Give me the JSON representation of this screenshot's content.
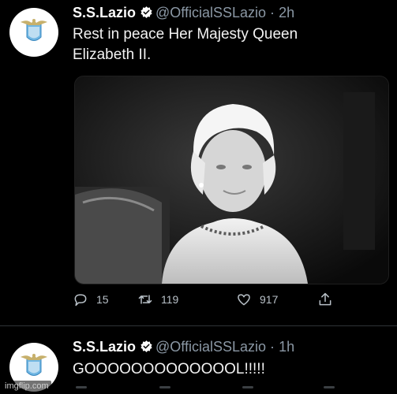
{
  "tweets": [
    {
      "author_name": "S.S.Lazio",
      "handle": "@OfficialSSLazio",
      "separator": "·",
      "time": "2h",
      "text_line1": "Rest in peace Her Majesty Queen",
      "text_line2": "Elizabeth II.",
      "media_icon": "portrait-photo",
      "stats": {
        "replies": "15",
        "retweets": "119",
        "likes": "917"
      }
    },
    {
      "author_name": "S.S.Lazio",
      "handle": "@OfficialSSLazio",
      "separator": "·",
      "time": "1h",
      "text": "GOOOOOOOOOOOOOL!!!!!"
    }
  ],
  "watermark": "imgflip.com",
  "colors": {
    "background": "#000000",
    "text": "#e7e9ea",
    "secondary": "#8b98a5",
    "verified_badge": "#ffffff",
    "lazio_blue": "#6fb6e3"
  },
  "icons": {
    "avatar": "lazio-eagle-crest-icon",
    "verified": "verified-badge-icon",
    "reply": "reply-icon",
    "retweet": "retweet-icon",
    "like": "heart-icon",
    "share": "share-icon"
  }
}
